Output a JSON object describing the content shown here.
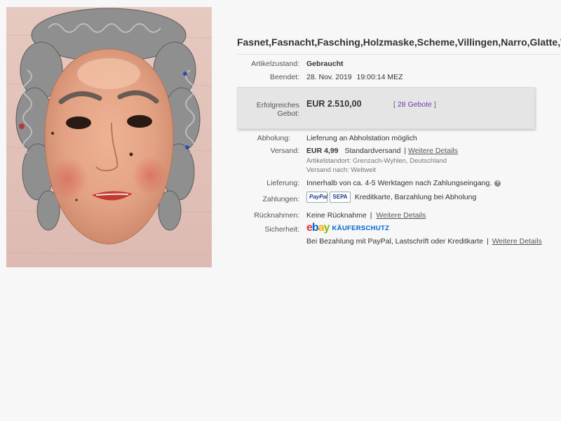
{
  "item": {
    "title": "Fasnet,Fasnacht,Fasching,Holzmaske,Scheme,Villingen,Narro,Glatte,Wö"
  },
  "details": {
    "condition": {
      "label": "Artikelzustand:",
      "value": "Gebraucht"
    },
    "ended": {
      "label": "Beendet:",
      "date": "28. Nov. 2019",
      "time": "19:00:14 MEZ"
    },
    "bid": {
      "label": "Erfolgreiches Gebot:",
      "amount": "EUR 2.510,00",
      "count_prefix": "[",
      "count": "28 Gebote",
      "count_suffix": "]"
    },
    "pickup": {
      "label": "Abholung:",
      "value": "Lieferung an Abholstation möglich"
    },
    "shipping": {
      "label": "Versand:",
      "price": "EUR 4,99",
      "method": "Standardversand",
      "separator": "|",
      "details_link": "Weitere Details",
      "location": "Artikelstandort:  Grenzach-Wyhlen, Deutschland",
      "ships_to": "Versand nach:  Weltweit"
    },
    "delivery": {
      "label": "Lieferung:",
      "value": "Innerhalb von ca. 4-5 Werktagen nach Zahlungseingang."
    },
    "payments": {
      "label": "Zahlungen:",
      "paypal": "PayPal",
      "sepa": "SEPA",
      "value": "Kreditkarte, Barzahlung bei Abholung"
    },
    "returns": {
      "label": "Rücknahmen:",
      "value": "Keine Rücknahme",
      "separator": "|",
      "details_link": "Weitere Details"
    },
    "security": {
      "label": "Sicherheit:",
      "ebay": [
        "e",
        "b",
        "a",
        "y"
      ],
      "protection": "KÄUFERSCHUTZ",
      "note": "Bei Bezahlung mit PayPal, Lastschrift oder Kreditkarte",
      "separator": "|",
      "details_link": "Weitere Details"
    }
  },
  "colors": {
    "background": "#f7f7f7",
    "bid_box": "#e5e5e5",
    "bid_count_link": "#6a3ab1",
    "ebay_blue": "#0064d2"
  }
}
